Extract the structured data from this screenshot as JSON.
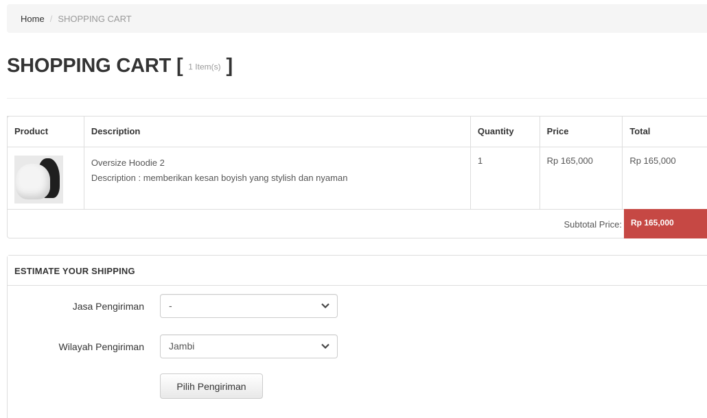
{
  "breadcrumb": {
    "home": "Home",
    "separator": "/",
    "current": "SHOPPING CART"
  },
  "page": {
    "title": "SHOPPING CART [",
    "item_count": "1 Item(s)",
    "title_close": "]"
  },
  "cart": {
    "headers": {
      "product": "Product",
      "description": "Description",
      "quantity": "Quantity",
      "price": "Price",
      "total": "Total"
    },
    "items": [
      {
        "image": "hoodie-thumbnail",
        "name": "Oversize Hoodie 2",
        "description": "Description : memberikan kesan boyish yang stylish dan nyaman",
        "quantity": "1",
        "price": "Rp 165,000",
        "total": "Rp 165,000"
      }
    ],
    "subtotal_label": "Subtotal Price:",
    "subtotal_value": "Rp 165,000"
  },
  "shipping": {
    "heading": "ESTIMATE YOUR SHIPPING",
    "courier_label": "Jasa Pengiriman",
    "courier_value": "-",
    "region_label": "Wilayah Pengiriman",
    "region_value": "Jambi",
    "submit_label": "Pilih Pengiriman"
  },
  "colors": {
    "subtotal_bg": "#c64844",
    "breadcrumb_bg": "#f5f5f5",
    "border": "#dddddd"
  }
}
